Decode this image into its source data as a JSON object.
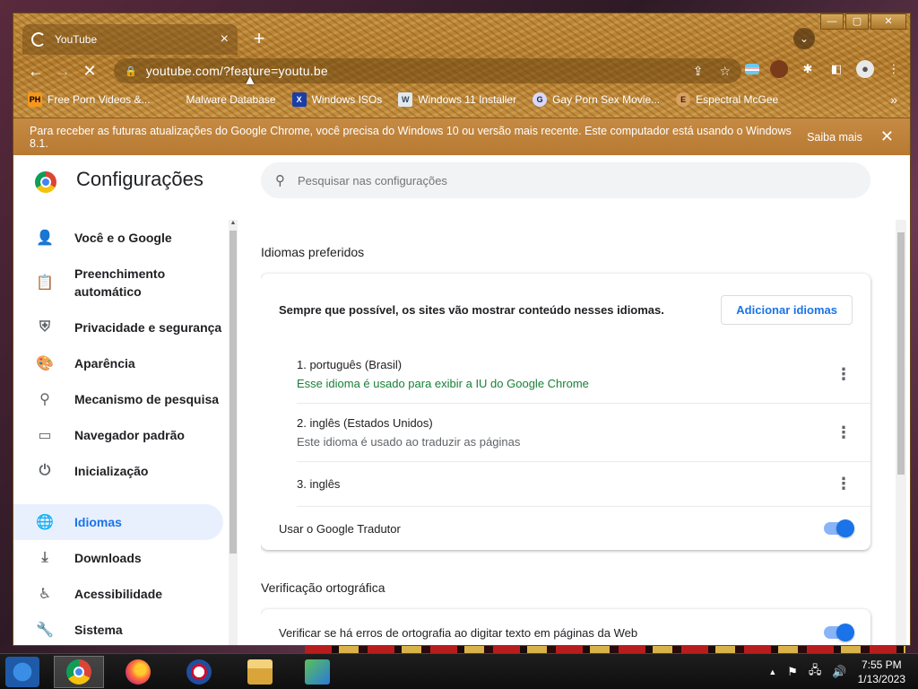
{
  "tab": {
    "title": "YouTube",
    "close": "×",
    "new_tab": "+",
    "search": "⌄"
  },
  "window_controls": {
    "minimize": "—",
    "maximize": "▢",
    "close": "✕"
  },
  "toolbar": {
    "back": "←",
    "forward": "→",
    "reload": "✕",
    "url": "youtube.com/?feature=youtu.be",
    "lock": "🔒",
    "share": "⇪",
    "star": "☆"
  },
  "bookmarks": [
    {
      "icon": "PH",
      "label": "Free Porn Videos &..."
    },
    {
      "icon": "",
      "label": "Malware Database"
    },
    {
      "icon": "X",
      "label": "Windows ISOs"
    },
    {
      "icon": "W",
      "label": "Windows 11 Installer"
    },
    {
      "icon": "G",
      "label": "Gay Porn Sex Movie..."
    },
    {
      "icon": "E",
      "label": "Espectral McGee"
    }
  ],
  "bookmarks_more": "»",
  "infobar": {
    "message": "Para receber as futuras atualizações do Google Chrome, você precisa do Windows 10 ou versão mais recente. Este computador está usando o Windows 8.1.",
    "link": "Saiba mais",
    "close": "✕"
  },
  "settings": {
    "title": "Configurações",
    "search_placeholder": "Pesquisar nas configurações"
  },
  "sidebar": {
    "items": [
      {
        "label": "Você e o Google",
        "icon": "person-icon"
      },
      {
        "label": "Preenchimento automático",
        "icon": "clipboard-icon"
      },
      {
        "label": "Privacidade e segurança",
        "icon": "shield-icon"
      },
      {
        "label": "Aparência",
        "icon": "palette-icon"
      },
      {
        "label": "Mecanismo de pesquisa",
        "icon": "search-icon"
      },
      {
        "label": "Navegador padrão",
        "icon": "browser-icon"
      },
      {
        "label": "Inicialização",
        "icon": "power-icon"
      },
      {
        "label": "Idiomas",
        "icon": "globe-icon"
      },
      {
        "label": "Downloads",
        "icon": "download-icon"
      },
      {
        "label": "Acessibilidade",
        "icon": "accessibility-icon"
      },
      {
        "label": "Sistema",
        "icon": "wrench-icon"
      }
    ],
    "active_index": 7
  },
  "languages": {
    "section_title": "Idiomas preferidos",
    "description": "Sempre que possível, os sites vão mostrar conteúdo nesses idiomas.",
    "add_button": "Adicionar idiomas",
    "items": [
      {
        "name": "1. português (Brasil)",
        "sub": "Esse idioma é usado para exibir a IU do Google Chrome"
      },
      {
        "name": "2. inglês (Estados Unidos)",
        "sub": "Este idioma é usado ao traduzir as páginas"
      },
      {
        "name": "3. inglês",
        "sub": ""
      }
    ],
    "kebab": "⋮",
    "translate_label": "Usar o Google Tradutor",
    "translate_on": true
  },
  "spellcheck": {
    "section_title": "Verificação ortográfica",
    "label": "Verificar se há erros de ortografia ao digitar texto em páginas da Web",
    "on": true
  },
  "taskbar": {
    "time": "7:55 PM",
    "date": "1/13/2023",
    "tray_expand": "▲",
    "flag": "⚑",
    "network": "🖧",
    "volume": "🔊"
  },
  "colors": {
    "accent": "#1a73e8",
    "frame": "#b37a2c",
    "active_bg": "#e8f0fe",
    "green_text": "#188038"
  }
}
